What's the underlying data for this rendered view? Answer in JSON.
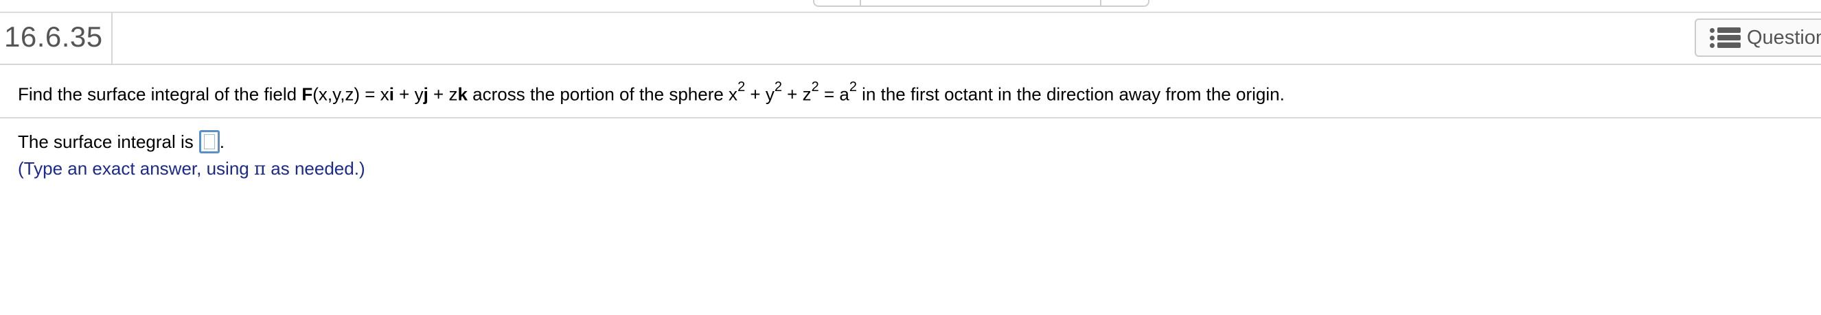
{
  "header": {
    "question_number": "16.6.35",
    "question_menu_label": "Question",
    "question_menu_icon": "list-icon"
  },
  "problem": {
    "pre": "Find the surface integral of the field ",
    "field_F": "F",
    "field_args": "(x,y,z) = x",
    "i": "i",
    "plus_y": " + y",
    "j": "j",
    "plus_z": " + z",
    "k": "k",
    "mid": " across the portion of the sphere x",
    "exp1": "2",
    "plus_y2": " + y",
    "exp2": "2",
    "plus_z2": " + z",
    "exp3": "2",
    "eq_a": " = a",
    "exp4": "2",
    "post": "  in the first octant in the direction away from the origin."
  },
  "answer": {
    "label": "The surface integral is",
    "period": ".",
    "value": ""
  },
  "hint": {
    "pre": "(Type an exact answer, using ",
    "pi": "π",
    "post": " as needed.)"
  },
  "colors": {
    "hint_text": "#1b2a8c",
    "answer_box_border": "#5b8fc7",
    "header_text": "#555555"
  }
}
